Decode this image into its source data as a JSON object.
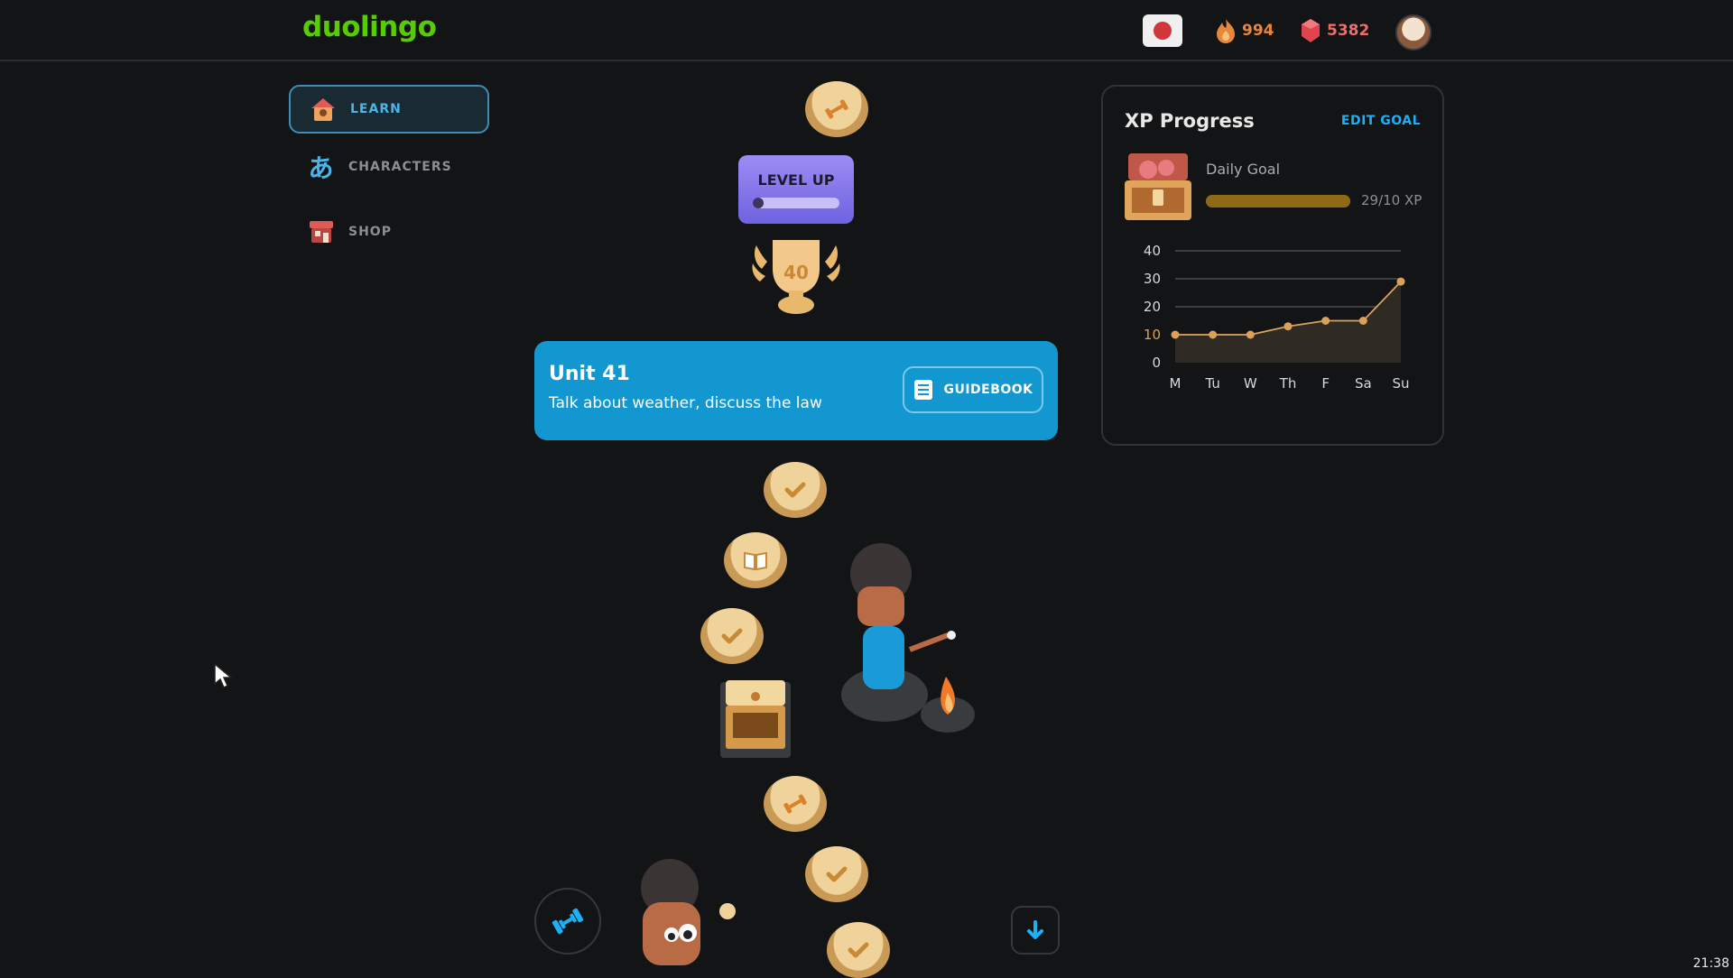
{
  "header": {
    "logo": "duolingo",
    "streak": "994",
    "gems": "5382"
  },
  "sidebar": {
    "items": [
      {
        "label": "LEARN",
        "icon": "home-icon"
      },
      {
        "label": "CHARACTERS",
        "icon": "hiragana-icon",
        "glyph": "あ"
      },
      {
        "label": "SHOP",
        "icon": "shop-icon"
      }
    ]
  },
  "path": {
    "level_up_label": "LEVEL UP",
    "level_up_progress": 0.12,
    "trophy_number": "40"
  },
  "unit": {
    "title": "Unit 41",
    "subtitle": "Talk about weather, discuss the law",
    "guidebook_label": "GUIDEBOOK"
  },
  "xp_card": {
    "title": "XP Progress",
    "edit_goal": "EDIT GOAL",
    "daily_goal_label": "Daily Goal",
    "daily_goal_value": "29/10 XP",
    "daily_goal_progress": 1.0
  },
  "chart_data": {
    "type": "line",
    "categories": [
      "M",
      "Tu",
      "W",
      "Th",
      "F",
      "Sa",
      "Su"
    ],
    "values": [
      10,
      10,
      10,
      13,
      15,
      15,
      29
    ],
    "yticks": [
      0,
      10,
      20,
      30,
      40
    ],
    "ylim": [
      0,
      40
    ],
    "goal": 10,
    "grid": true
  },
  "colors": {
    "accent_blue": "#1397d0",
    "brand_green": "#58cc02",
    "line_color": "#d9a15a"
  },
  "clock": "21:38"
}
